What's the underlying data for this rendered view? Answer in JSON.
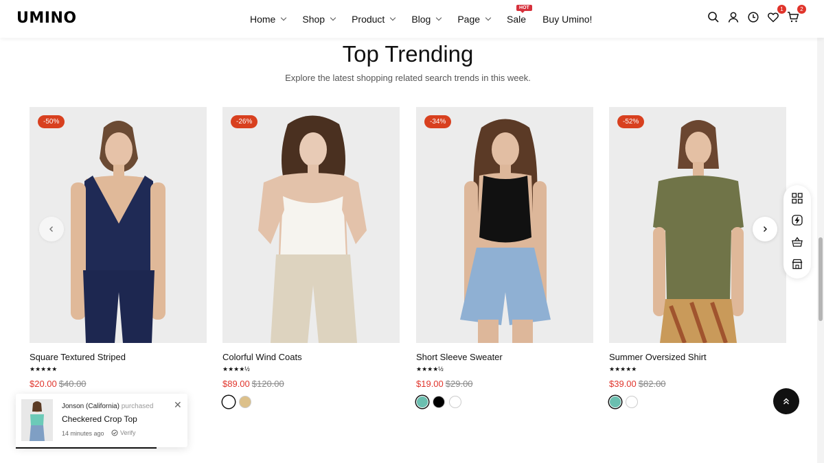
{
  "brand": {
    "logo": "UMINO"
  },
  "nav": {
    "items": [
      {
        "label": "Home",
        "dropdown": true
      },
      {
        "label": "Shop",
        "dropdown": true
      },
      {
        "label": "Product",
        "dropdown": true
      },
      {
        "label": "Blog",
        "dropdown": true
      },
      {
        "label": "Page",
        "dropdown": true
      },
      {
        "label": "Sale",
        "badge": "HOT"
      },
      {
        "label": "Buy Umino!"
      }
    ]
  },
  "header_icons": {
    "wishlist_count": "1",
    "cart_count": "2"
  },
  "section": {
    "title": "Top Trending",
    "subtitle": "Explore the latest shopping related search trends in this week."
  },
  "products": [
    {
      "badge": "-50%",
      "name": "Square Textured Striped",
      "stars": "★★★★★",
      "price": "$20.00",
      "old_price": "$40.00",
      "swatches": []
    },
    {
      "badge": "-26%",
      "name": "Colorful Wind Coats",
      "stars": "★★★★½",
      "price": "$89.00",
      "old_price": "$120.00",
      "swatches": [
        "#ffffff",
        "#dcc08a"
      ]
    },
    {
      "badge": "-34%",
      "name": "Short Sleeve Sweater",
      "stars": "★★★★½",
      "price": "$19.00",
      "old_price": "$29.00",
      "swatches": [
        "#6bbfb0",
        "#000000",
        "#ffffff"
      ]
    },
    {
      "badge": "-52%",
      "name": "Summer Oversized Shirt",
      "stars": "★★★★★",
      "price": "$39.00",
      "old_price": "$82.00",
      "swatches": [
        "#6bbfb0",
        "#ffffff"
      ]
    }
  ],
  "popup": {
    "buyer": "Jonson (California)",
    "action": "purchased",
    "product": "Checkered Crop Top",
    "time": "14 minutes ago",
    "verify": "Verify",
    "progress": 0.82
  },
  "colors": {
    "accent": "#e0342b",
    "badge": "#d8401f",
    "text": "#111111"
  },
  "icons": {
    "header": [
      "search-icon",
      "user-icon",
      "clock-icon",
      "heart-icon",
      "cart-icon"
    ],
    "side_tools": [
      "grid-icon",
      "lightning-icon",
      "basket-icon",
      "store-icon"
    ]
  }
}
